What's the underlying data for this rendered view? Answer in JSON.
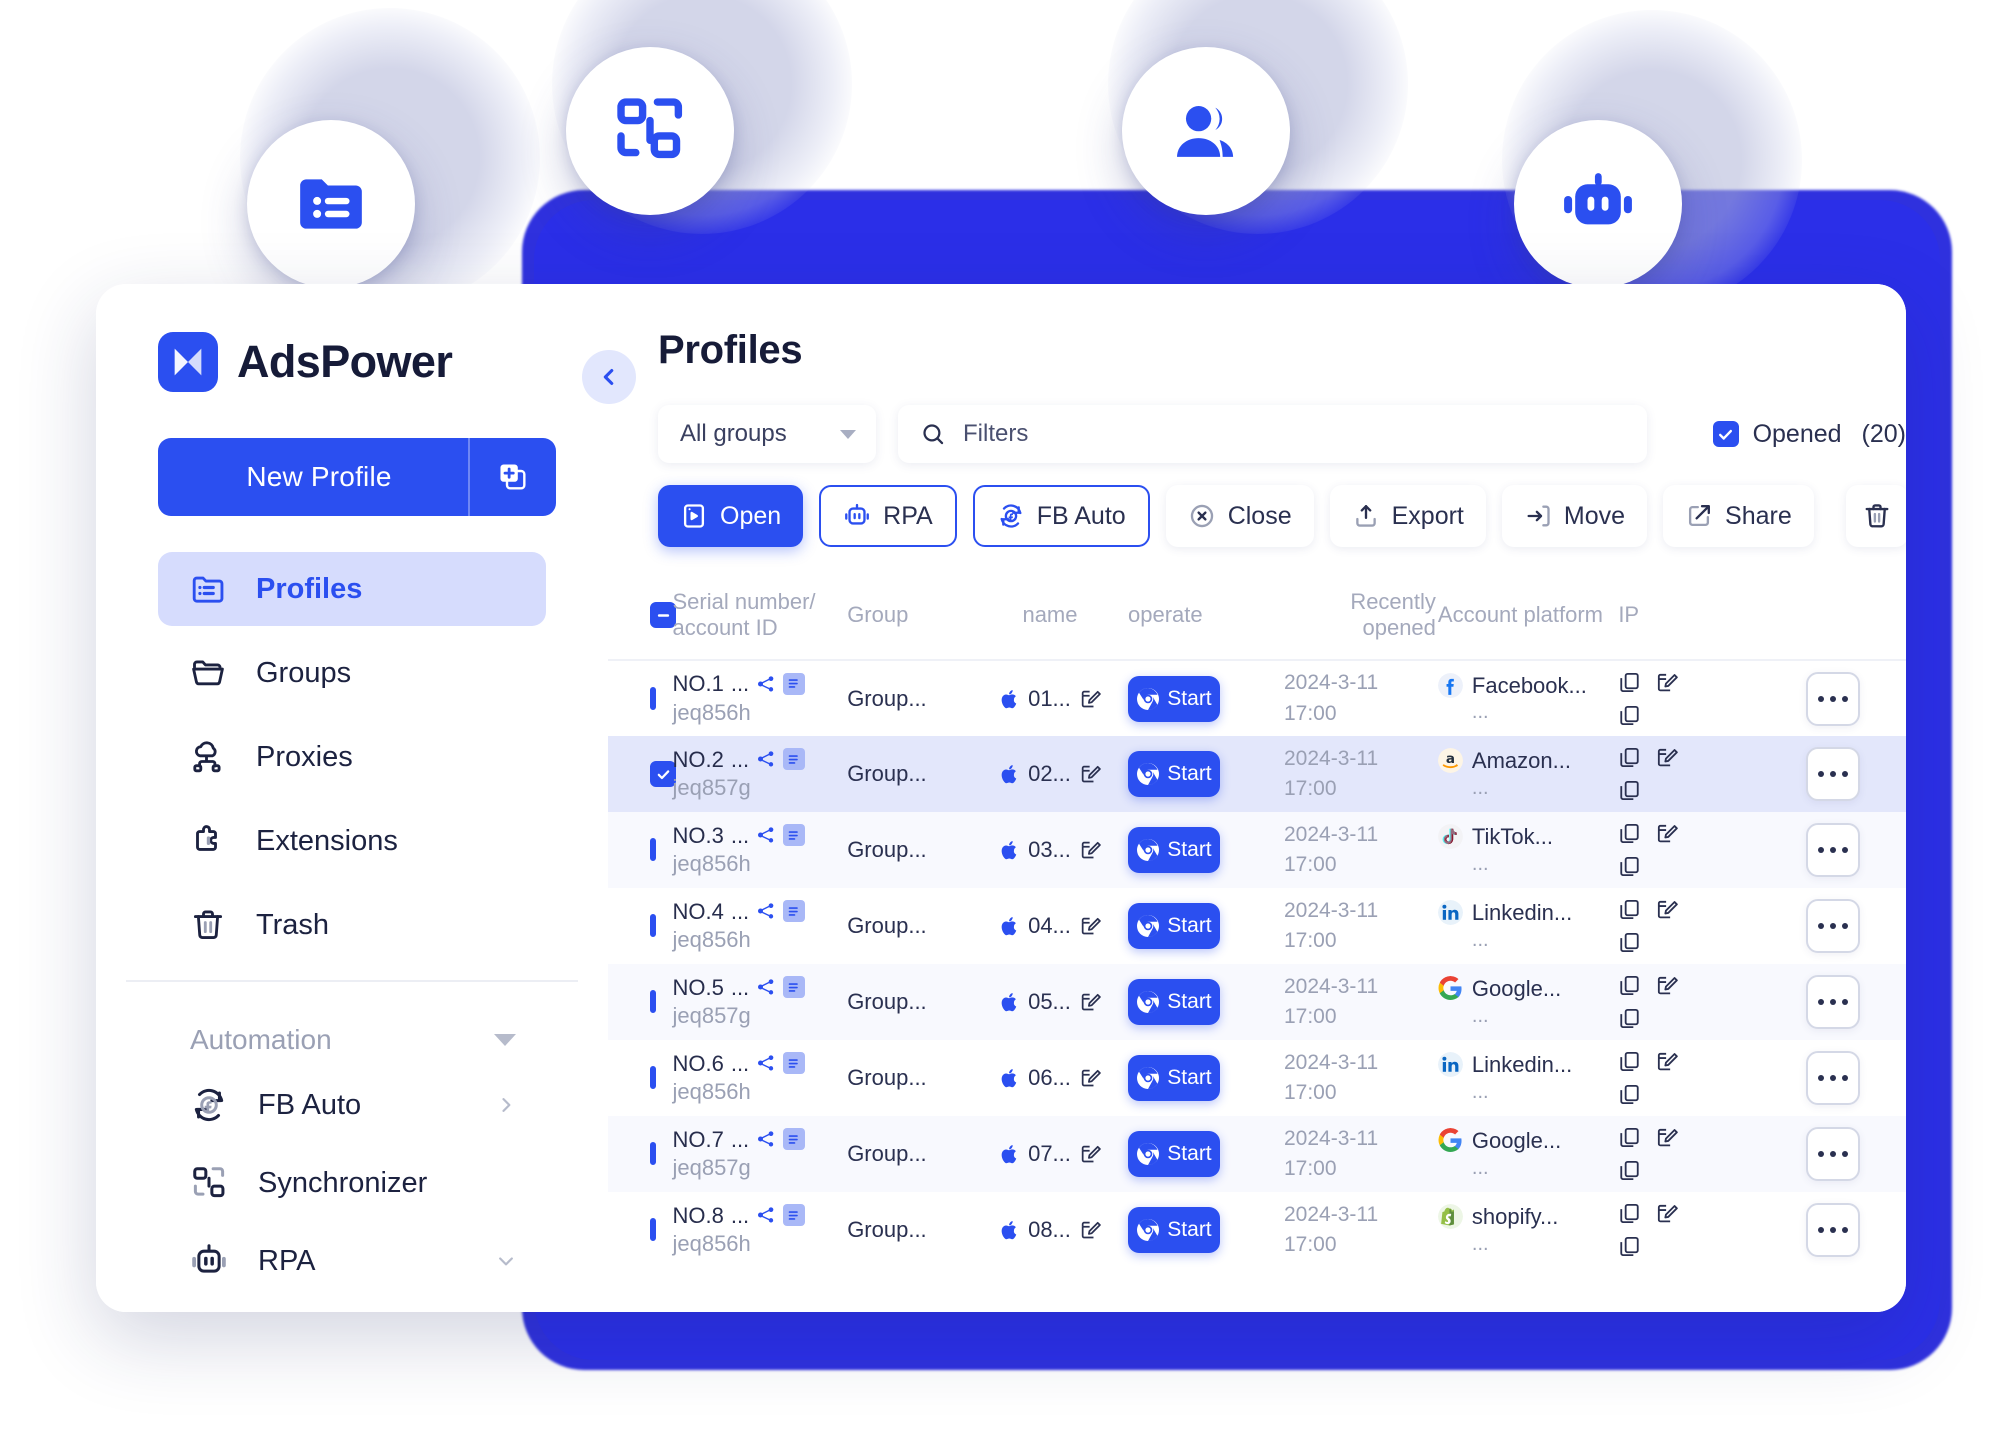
{
  "brand": {
    "name": "AdsPower"
  },
  "sidebar": {
    "new_profile_label": "New Profile",
    "items": [
      {
        "label": "Profiles",
        "icon": "folder-list-icon"
      },
      {
        "label": "Groups",
        "icon": "folder-icon"
      },
      {
        "label": "Proxies",
        "icon": "proxy-cloud-icon"
      },
      {
        "label": "Extensions",
        "icon": "puzzle-icon"
      },
      {
        "label": "Trash",
        "icon": "trash-icon"
      }
    ],
    "automation": {
      "section_label": "Automation",
      "items": [
        {
          "label": "FB Auto",
          "icon": "facebook-sync-icon",
          "chevron": "chevron-right-icon"
        },
        {
          "label": "Synchronizer",
          "icon": "synchronizer-icon",
          "chevron": ""
        },
        {
          "label": "RPA",
          "icon": "robot-icon",
          "chevron": "chevron-down-icon"
        }
      ]
    }
  },
  "header": {
    "title": "Profiles"
  },
  "toolbar": {
    "group_select": "All groups",
    "search_placeholder": "Filters",
    "opened_label": "Opened",
    "opened_count": "(20)",
    "buttons": [
      {
        "label": "Open",
        "icon": "open-icon",
        "style": "primary"
      },
      {
        "label": "RPA",
        "icon": "robot-icon",
        "style": "outline"
      },
      {
        "label": "FB Auto",
        "icon": "fb-sync-icon",
        "style": "outline"
      },
      {
        "label": "Close",
        "icon": "close-icon",
        "style": "plain"
      },
      {
        "label": "Export",
        "icon": "export-icon",
        "style": "plain"
      },
      {
        "label": "Move",
        "icon": "move-icon",
        "style": "plain"
      },
      {
        "label": "Share",
        "icon": "share-icon",
        "style": "plain"
      }
    ],
    "delete_icon": "trash-icon",
    "more_icon": "more-icon"
  },
  "table": {
    "columns": [
      "Serial number/\naccount ID",
      "Group",
      "name",
      "operate",
      "Recently opened",
      "Account platform",
      "IP"
    ],
    "col_serial_line1": "Serial number/",
    "col_serial_line2": "account ID",
    "col_group": "Group",
    "col_name": "name",
    "col_operate": "operate",
    "col_recent": "Recently opened",
    "col_platform": "Account platform",
    "col_ip": "IP",
    "start_label": "Start",
    "rows": [
      {
        "serial": "NO.1",
        "serial_dots": "...",
        "account_id": "jeq856h",
        "group": "Group...",
        "name": "01...",
        "date": "2024-3-11",
        "time": "17:00",
        "platform": "Facebook...",
        "platform_sub": "...",
        "platform_icon": "facebook-icon",
        "selected": false,
        "alt": false
      },
      {
        "serial": "NO.2",
        "serial_dots": "...",
        "account_id": "jeq857g",
        "group": "Group...",
        "name": "02...",
        "date": "2024-3-11",
        "time": "17:00",
        "platform": "Amazon...",
        "platform_sub": "...",
        "platform_icon": "amazon-icon",
        "selected": true,
        "alt": false
      },
      {
        "serial": "NO.3",
        "serial_dots": "...",
        "account_id": "jeq856h",
        "group": "Group...",
        "name": "03...",
        "date": "2024-3-11",
        "time": "17:00",
        "platform": "TikTok...",
        "platform_sub": "...",
        "platform_icon": "tiktok-icon",
        "selected": false,
        "alt": true
      },
      {
        "serial": "NO.4",
        "serial_dots": "...",
        "account_id": "jeq856h",
        "group": "Group...",
        "name": "04...",
        "date": "2024-3-11",
        "time": "17:00",
        "platform": "Linkedin...",
        "platform_sub": "...",
        "platform_icon": "linkedin-icon",
        "selected": false,
        "alt": false
      },
      {
        "serial": "NO.5",
        "serial_dots": "...",
        "account_id": "jeq857g",
        "group": "Group...",
        "name": "05...",
        "date": "2024-3-11",
        "time": "17:00",
        "platform": "Google...",
        "platform_sub": "...",
        "platform_icon": "google-icon",
        "selected": false,
        "alt": true
      },
      {
        "serial": "NO.6",
        "serial_dots": "...",
        "account_id": "jeq856h",
        "group": "Group...",
        "name": "06...",
        "date": "2024-3-11",
        "time": "17:00",
        "platform": "Linkedin...",
        "platform_sub": "...",
        "platform_icon": "linkedin-icon",
        "selected": false,
        "alt": false
      },
      {
        "serial": "NO.7",
        "serial_dots": "...",
        "account_id": "jeq857g",
        "group": "Group...",
        "name": "07...",
        "date": "2024-3-11",
        "time": "17:00",
        "platform": "Google...",
        "platform_sub": "...",
        "platform_icon": "google-icon",
        "selected": false,
        "alt": true
      },
      {
        "serial": "NO.8",
        "serial_dots": "...",
        "account_id": "jeq856h",
        "group": "Group...",
        "name": "08...",
        "date": "2024-3-11",
        "time": "17:00",
        "platform": "shopify...",
        "platform_sub": "...",
        "platform_icon": "shopify-icon",
        "selected": false,
        "alt": false
      }
    ]
  },
  "floating_badges": [
    {
      "icon": "folder-list-icon"
    },
    {
      "icon": "synchronizer-icon"
    },
    {
      "icon": "users-icon"
    },
    {
      "icon": "robot-icon"
    }
  ],
  "colors": {
    "accent": "#2B4FF0",
    "backdrop": "#2F31DE",
    "selected_row": "#E3E7FB",
    "alt_row": "#F8F9FE",
    "active_nav": "#D6DCFD",
    "text_dark": "#161B38",
    "text_muted": "#9AA0B4"
  }
}
